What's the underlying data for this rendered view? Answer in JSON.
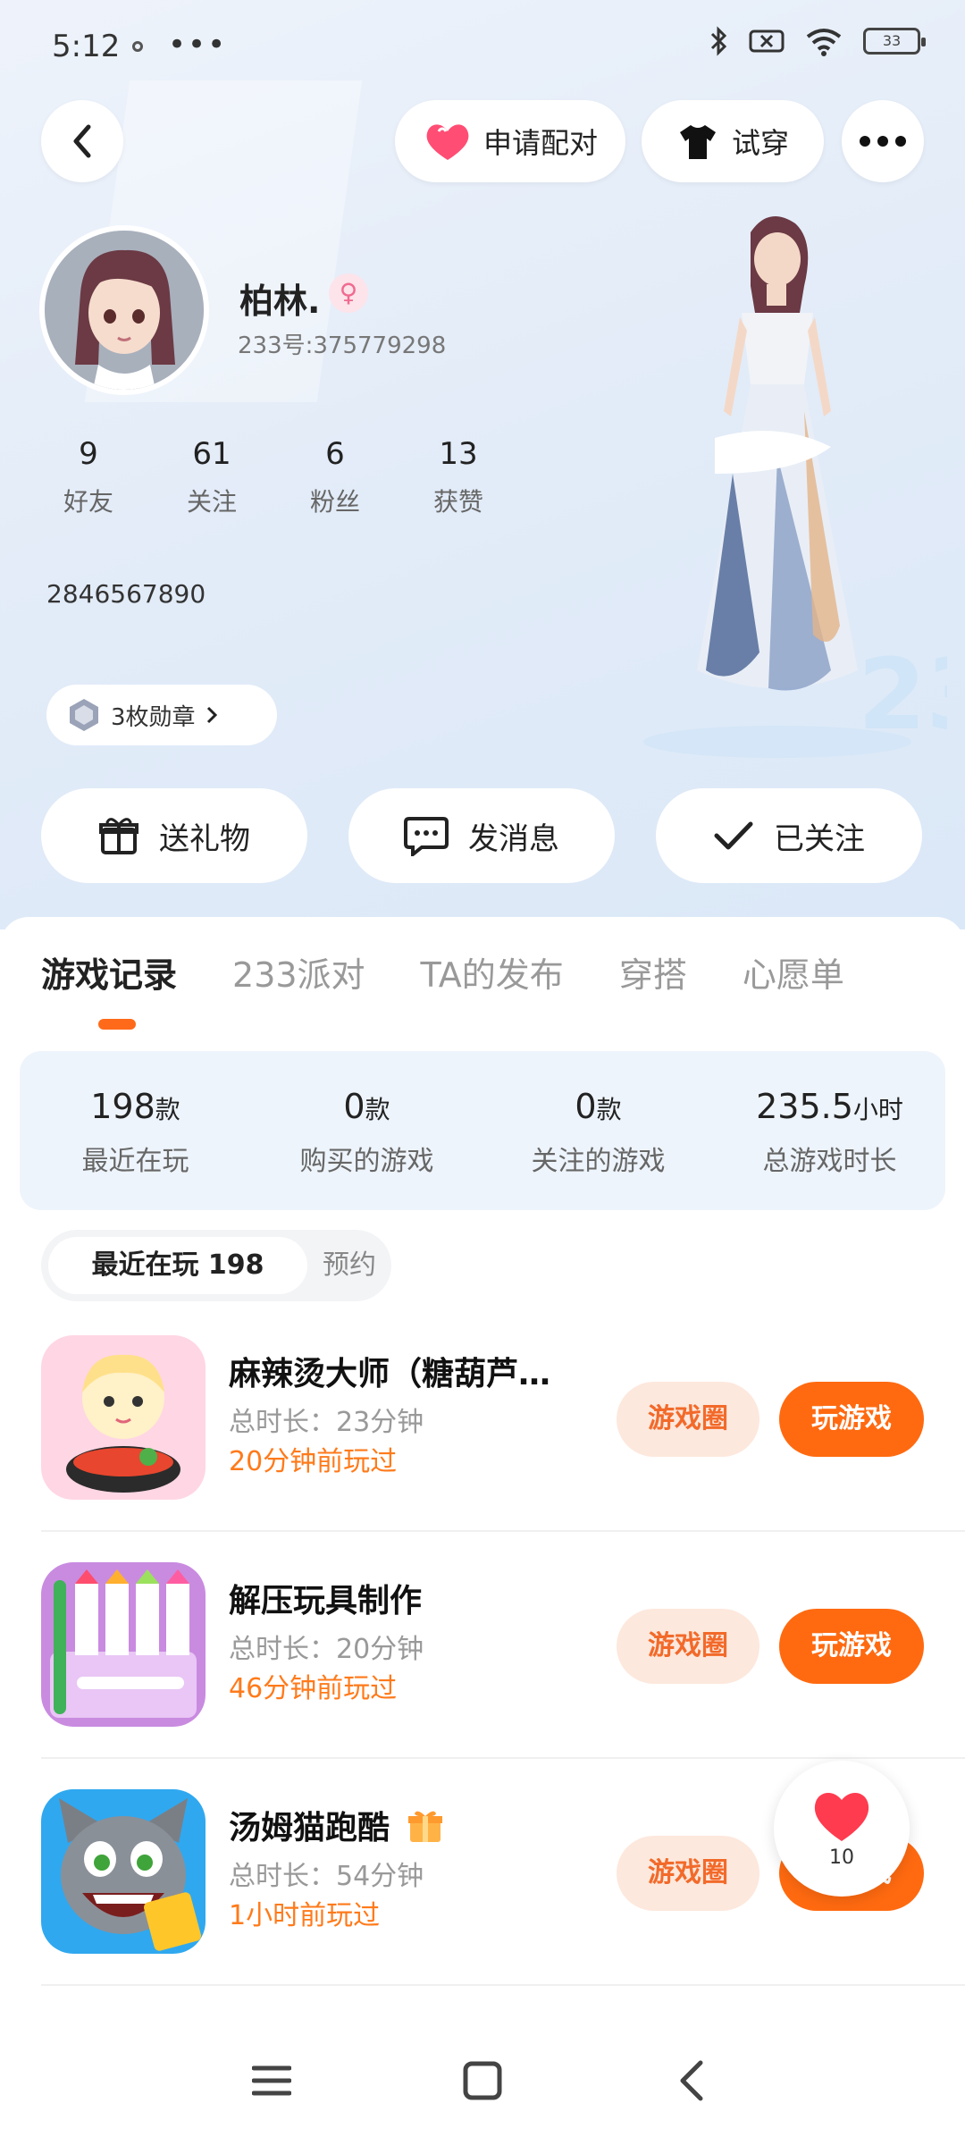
{
  "status": {
    "time": "5:12",
    "dots": "•••",
    "battery": "33"
  },
  "header": {
    "pair_label": "申请配对",
    "try_label": "试穿"
  },
  "profile": {
    "name": "柏林.",
    "gender_symbol": "♀",
    "uid": "233号:375779298",
    "stats": [
      {
        "value": "9",
        "label": "好友"
      },
      {
        "value": "61",
        "label": "关注"
      },
      {
        "value": "6",
        "label": "粉丝"
      },
      {
        "value": "13",
        "label": "获赞"
      }
    ],
    "bio": "2846567890",
    "medal": "3枚勋章"
  },
  "actions": {
    "gift": "送礼物",
    "message": "发消息",
    "follow": "已关注"
  },
  "tabs": [
    "游戏记录",
    "233派对",
    "TA的发布",
    "穿搭",
    "心愿单"
  ],
  "summary": [
    {
      "value": "198",
      "unit": "款",
      "label": "最近在玩"
    },
    {
      "value": "0",
      "unit": "款",
      "label": "购买的游戏"
    },
    {
      "value": "0",
      "unit": "款",
      "label": "关注的游戏"
    },
    {
      "value": "235.5",
      "unit": "小时",
      "label": "总游戏时长"
    }
  ],
  "segment": {
    "active": "最近在玩 198",
    "inactive": "预约"
  },
  "games": [
    {
      "title": "麻辣烫大师（糖葫芦…",
      "duration": "总时长：23分钟",
      "ago": "20分钟前玩过",
      "circle": "游戏圈",
      "play": "玩游戏"
    },
    {
      "title": "解压玩具制作",
      "duration": "总时长：20分钟",
      "ago": "46分钟前玩过",
      "circle": "游戏圈",
      "play": "玩游戏"
    },
    {
      "title": "汤姆猫跑酷",
      "duration": "总时长：54分钟",
      "ago": "1小时前玩过",
      "circle": "游戏圈",
      "play": "玩游戏"
    }
  ],
  "fab": {
    "count": "10"
  },
  "colors": {
    "accent": "#ff6a10",
    "accent_soft": "#fde8dd",
    "heart": "#ff3b4f"
  }
}
